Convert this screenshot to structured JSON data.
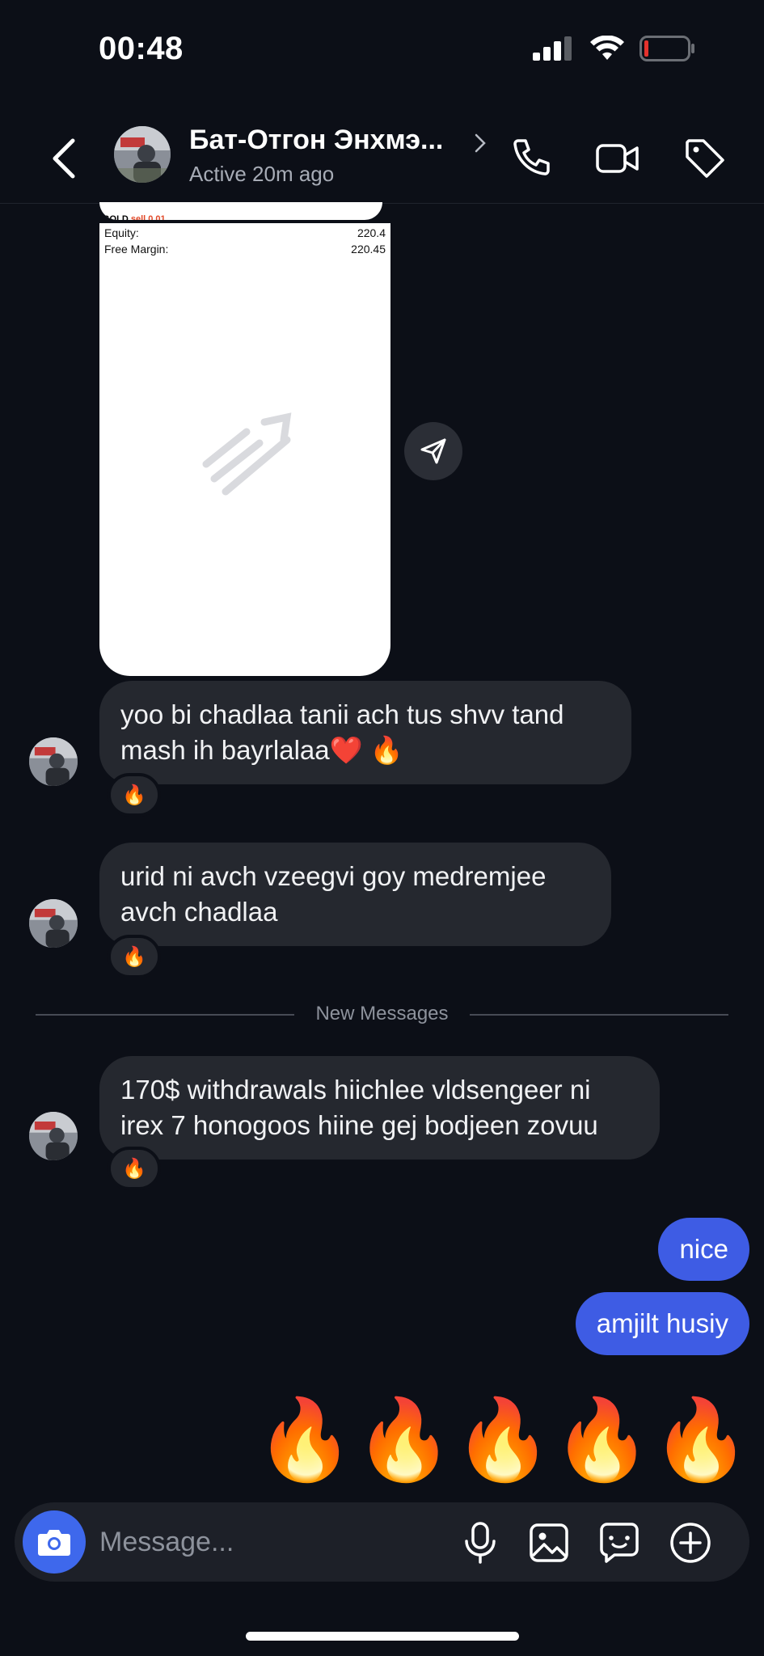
{
  "status_bar": {
    "time": "00:48"
  },
  "header": {
    "contact_name": "Бат-Отгон Энхмэ...",
    "contact_status": "Active 20m ago",
    "icons": [
      "back-chevron-icon",
      "phone-icon",
      "video-icon",
      "tag-icon"
    ]
  },
  "image_message": {
    "rows": [
      {
        "label": "Equity:",
        "value": "220.4"
      },
      {
        "label": "Free Margin:",
        "value": "220.45"
      }
    ]
  },
  "messages": [
    {
      "text": "yoo bi chadlaa tanii ach tus shvv tand mash ih bayrlalaa❤️ 🔥",
      "reaction": "🔥"
    },
    {
      "text": "urid ni avch vzeegvi goy medremjee avch chadlaa",
      "reaction": "🔥"
    },
    {
      "text": "170$ withdrawals hiichlee vldsengeer ni irex 7 honogoos hiine gej bodjeen zovuu",
      "reaction": "🔥"
    }
  ],
  "divider": {
    "label": "New Messages"
  },
  "outgoing": [
    {
      "text": "nice"
    },
    {
      "text": "amjilt husiy"
    }
  ],
  "emoji_row": [
    "🔥",
    "🔥",
    "🔥",
    "🔥",
    "🔥"
  ],
  "composer": {
    "placeholder": "Message...",
    "icons": [
      "camera-icon",
      "microphone-icon",
      "gallery-icon",
      "sticker-icon",
      "plus-icon"
    ]
  },
  "colors": {
    "background": "#0c0f17",
    "bubble_in": "#25282f",
    "bubble_out": "#3e5ce4",
    "camera": "#3e68ec",
    "battery_low": "#e5322d"
  }
}
